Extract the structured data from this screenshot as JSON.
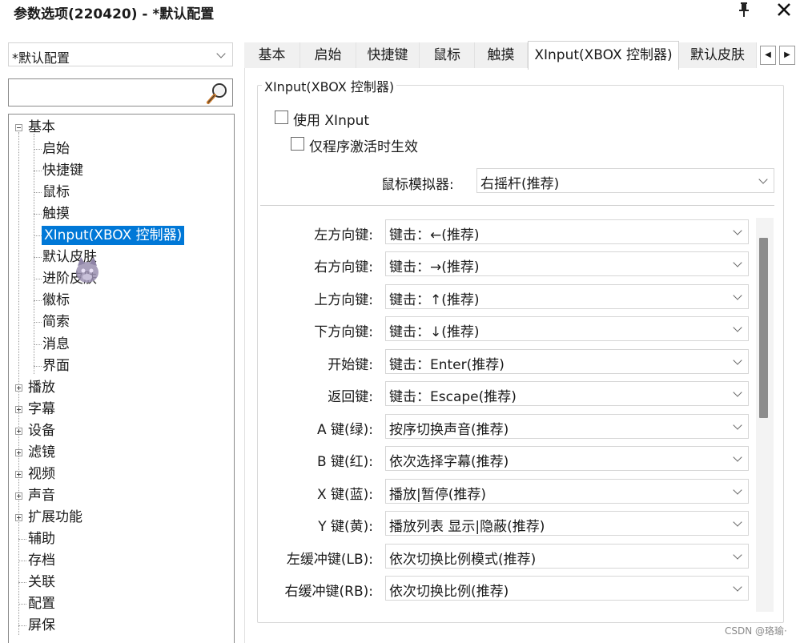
{
  "window": {
    "title": "参数选项(220420) - *默认配置"
  },
  "profile_select": {
    "value": "*默认配置"
  },
  "search": {
    "value": ""
  },
  "tree": [
    {
      "label": "基本",
      "expander": "minus"
    },
    {
      "label": "启始"
    },
    {
      "label": "快捷键"
    },
    {
      "label": "鼠标"
    },
    {
      "label": "触摸"
    },
    {
      "label": "XInput(XBOX 控制器)",
      "selected": true
    },
    {
      "label": "默认皮肤"
    },
    {
      "label": "进阶皮肤"
    },
    {
      "label": "徽标"
    },
    {
      "label": "简索"
    },
    {
      "label": "消息"
    },
    {
      "label": "界面"
    },
    {
      "label": "播放",
      "expander": "plus"
    },
    {
      "label": "字幕",
      "expander": "plus"
    },
    {
      "label": "设备",
      "expander": "plus"
    },
    {
      "label": "滤镜",
      "expander": "plus"
    },
    {
      "label": "视频",
      "expander": "plus"
    },
    {
      "label": "声音",
      "expander": "plus"
    },
    {
      "label": "扩展功能",
      "expander": "plus"
    },
    {
      "label": "辅助"
    },
    {
      "label": "存档"
    },
    {
      "label": "关联"
    },
    {
      "label": "配置"
    },
    {
      "label": "屏保"
    }
  ],
  "tabs": [
    {
      "label": "基本"
    },
    {
      "label": "启始"
    },
    {
      "label": "快捷键"
    },
    {
      "label": "鼠标"
    },
    {
      "label": "触摸"
    },
    {
      "label": "XInput(XBOX 控制器)",
      "active": true
    },
    {
      "label": "默认皮肤"
    }
  ],
  "tab_scroll": {
    "left": "◀",
    "right": "▶"
  },
  "panel": {
    "group_title": "XInput(XBOX 控制器)",
    "use_xinput": {
      "label": "使用 XInput",
      "checked": false
    },
    "only_active": {
      "label": "仅程序激活时生效",
      "checked": false
    },
    "mouse_emulator": {
      "label": "鼠标模拟器:",
      "value": "右摇杆(推荐)"
    },
    "mappings": [
      {
        "label": "左方向键:",
        "value": "键击：←(推荐)"
      },
      {
        "label": "右方向键:",
        "value": "键击：→(推荐)"
      },
      {
        "label": "上方向键:",
        "value": "键击：↑(推荐)"
      },
      {
        "label": "下方向键:",
        "value": "键击：↓(推荐)"
      },
      {
        "label": "开始键:",
        "value": "键击：Enter(推荐)"
      },
      {
        "label": "返回键:",
        "value": "键击：Escape(推荐)"
      },
      {
        "label": "A 键(绿):",
        "value": "按序切换声音(推荐)"
      },
      {
        "label": "B 键(红):",
        "value": "依次选择字幕(推荐)"
      },
      {
        "label": "X 键(蓝):",
        "value": "播放|暂停(推荐)"
      },
      {
        "label": "Y 键(黄):",
        "value": "播放列表 显示|隐蔽(推荐)"
      },
      {
        "label": "左缓冲键(LB):",
        "value": "依次切换比例模式(推荐)"
      },
      {
        "label": "右缓冲键(RB):",
        "value": "依次切换比例(推荐)"
      }
    ]
  },
  "watermark": "CSDN @珞瑜·"
}
